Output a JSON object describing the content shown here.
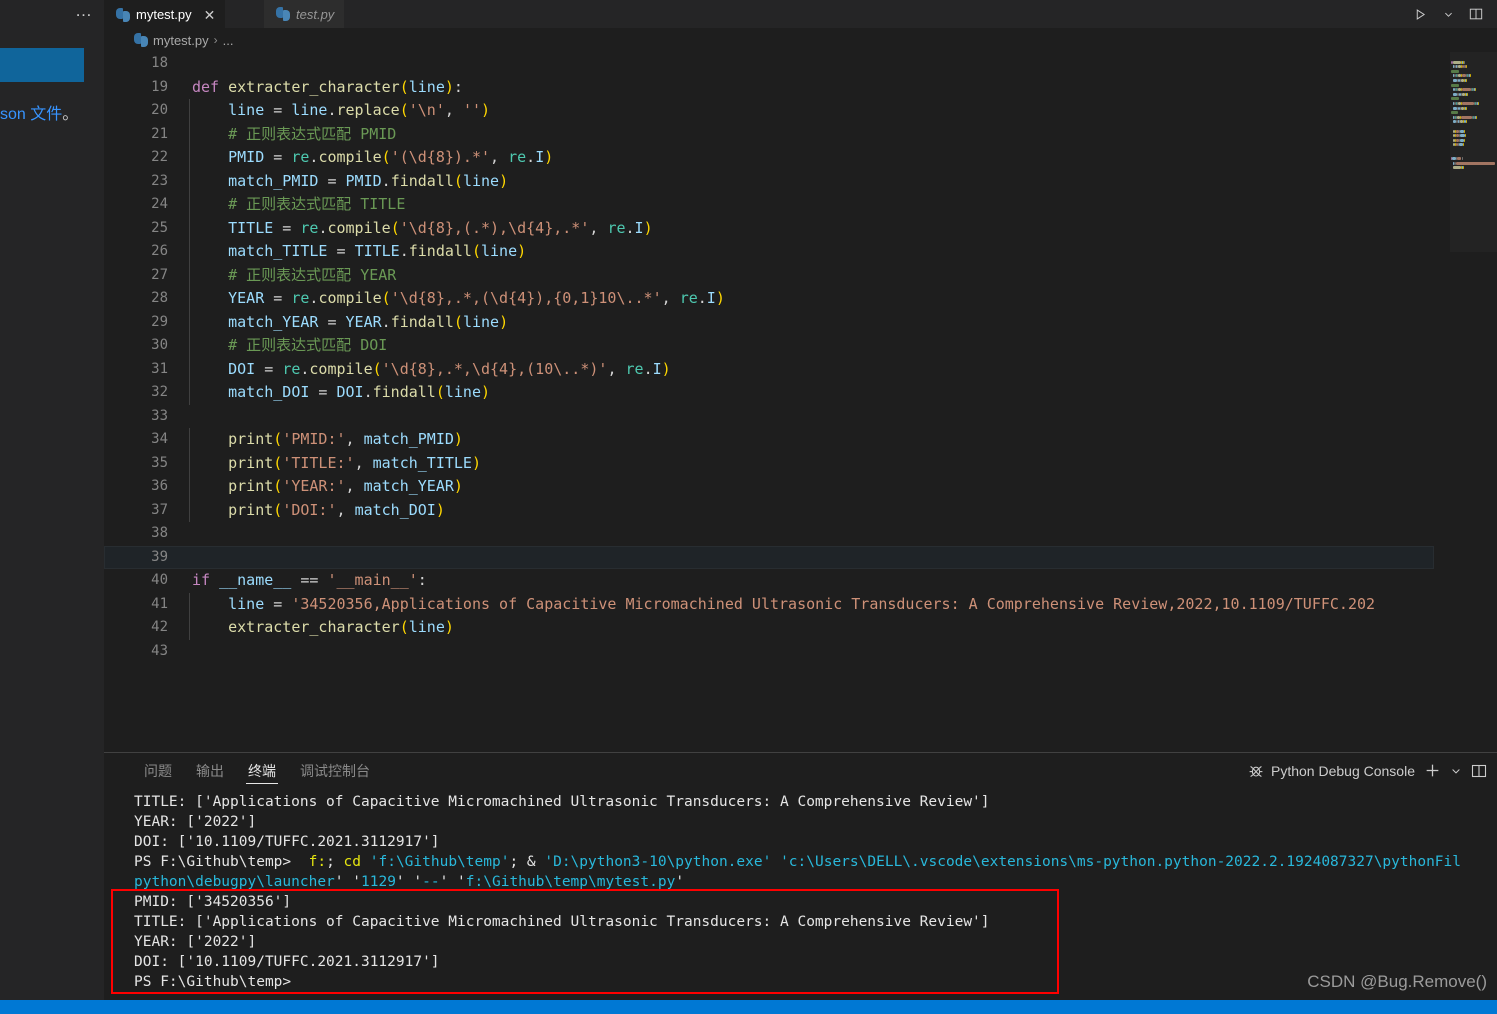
{
  "window": {
    "more_actions": "…"
  },
  "tabs": [
    {
      "label": "mytest.py",
      "icon": "python-file-icon",
      "active": true,
      "close": "✕"
    },
    {
      "label": "test.py",
      "icon": "python-file-icon",
      "active": false
    }
  ],
  "title_actions": [
    {
      "name": "run-python-file-button",
      "icon": "play-icon"
    },
    {
      "name": "run-options-dropdown",
      "icon": "chevron-down-icon"
    },
    {
      "name": "split-editor-right-button",
      "icon": "split-editor-icon"
    }
  ],
  "breadcrumb": {
    "icon": "python-file-icon",
    "file": "mytest.py",
    "separator": "›",
    "symbol": "..."
  },
  "left_panel_fragment": {
    "text_blue": "son 文件",
    "text_rest": "。"
  },
  "editor": {
    "first_line_number": 18,
    "current_line": 39,
    "lines": [
      {
        "n": 18,
        "tokens": []
      },
      {
        "n": 19,
        "tokens": [
          {
            "t": "def ",
            "c": "kw"
          },
          {
            "t": "extracter_character",
            "c": "fn"
          },
          {
            "t": "(",
            "c": "pnY"
          },
          {
            "t": "line",
            "c": "var"
          },
          {
            "t": ")",
            "c": "pnY"
          },
          {
            "t": ":",
            "c": "pn"
          }
        ]
      },
      {
        "n": 20,
        "tokens": [
          {
            "t": "    ",
            "c": "pn"
          },
          {
            "t": "line",
            "c": "var"
          },
          {
            "t": " = ",
            "c": "pn"
          },
          {
            "t": "line",
            "c": "var"
          },
          {
            "t": ".",
            "c": "pn"
          },
          {
            "t": "replace",
            "c": "fn"
          },
          {
            "t": "(",
            "c": "pnY"
          },
          {
            "t": "'\\n'",
            "c": "str"
          },
          {
            "t": ", ",
            "c": "pn"
          },
          {
            "t": "''",
            "c": "str"
          },
          {
            "t": ")",
            "c": "pnY"
          }
        ]
      },
      {
        "n": 21,
        "tokens": [
          {
            "t": "    # 正则表达式匹配 PMID",
            "c": "com"
          }
        ]
      },
      {
        "n": 22,
        "tokens": [
          {
            "t": "    ",
            "c": "pn"
          },
          {
            "t": "PMID",
            "c": "var"
          },
          {
            "t": " = ",
            "c": "pn"
          },
          {
            "t": "re",
            "c": "cls"
          },
          {
            "t": ".",
            "c": "pn"
          },
          {
            "t": "compile",
            "c": "fn"
          },
          {
            "t": "(",
            "c": "pnY"
          },
          {
            "t": "'(\\d{8}).*'",
            "c": "str"
          },
          {
            "t": ", ",
            "c": "pn"
          },
          {
            "t": "re",
            "c": "cls"
          },
          {
            "t": ".",
            "c": "pn"
          },
          {
            "t": "I",
            "c": "var"
          },
          {
            "t": ")",
            "c": "pnY"
          }
        ]
      },
      {
        "n": 23,
        "tokens": [
          {
            "t": "    ",
            "c": "pn"
          },
          {
            "t": "match_PMID",
            "c": "var"
          },
          {
            "t": " = ",
            "c": "pn"
          },
          {
            "t": "PMID",
            "c": "var"
          },
          {
            "t": ".",
            "c": "pn"
          },
          {
            "t": "findall",
            "c": "fn"
          },
          {
            "t": "(",
            "c": "pnY"
          },
          {
            "t": "line",
            "c": "var"
          },
          {
            "t": ")",
            "c": "pnY"
          }
        ]
      },
      {
        "n": 24,
        "tokens": [
          {
            "t": "    # 正则表达式匹配 TITLE",
            "c": "com"
          }
        ]
      },
      {
        "n": 25,
        "tokens": [
          {
            "t": "    ",
            "c": "pn"
          },
          {
            "t": "TITLE",
            "c": "var"
          },
          {
            "t": " = ",
            "c": "pn"
          },
          {
            "t": "re",
            "c": "cls"
          },
          {
            "t": ".",
            "c": "pn"
          },
          {
            "t": "compile",
            "c": "fn"
          },
          {
            "t": "(",
            "c": "pnY"
          },
          {
            "t": "'\\d{8},(.*),\\d{4},.*'",
            "c": "str"
          },
          {
            "t": ", ",
            "c": "pn"
          },
          {
            "t": "re",
            "c": "cls"
          },
          {
            "t": ".",
            "c": "pn"
          },
          {
            "t": "I",
            "c": "var"
          },
          {
            "t": ")",
            "c": "pnY"
          }
        ]
      },
      {
        "n": 26,
        "tokens": [
          {
            "t": "    ",
            "c": "pn"
          },
          {
            "t": "match_TITLE",
            "c": "var"
          },
          {
            "t": " = ",
            "c": "pn"
          },
          {
            "t": "TITLE",
            "c": "var"
          },
          {
            "t": ".",
            "c": "pn"
          },
          {
            "t": "findall",
            "c": "fn"
          },
          {
            "t": "(",
            "c": "pnY"
          },
          {
            "t": "line",
            "c": "var"
          },
          {
            "t": ")",
            "c": "pnY"
          }
        ]
      },
      {
        "n": 27,
        "tokens": [
          {
            "t": "    # 正则表达式匹配 YEAR",
            "c": "com"
          }
        ]
      },
      {
        "n": 28,
        "tokens": [
          {
            "t": "    ",
            "c": "pn"
          },
          {
            "t": "YEAR",
            "c": "var"
          },
          {
            "t": " = ",
            "c": "pn"
          },
          {
            "t": "re",
            "c": "cls"
          },
          {
            "t": ".",
            "c": "pn"
          },
          {
            "t": "compile",
            "c": "fn"
          },
          {
            "t": "(",
            "c": "pnY"
          },
          {
            "t": "'\\d{8},.*,(\\d{4}),{0,1}10\\..*'",
            "c": "str"
          },
          {
            "t": ", ",
            "c": "pn"
          },
          {
            "t": "re",
            "c": "cls"
          },
          {
            "t": ".",
            "c": "pn"
          },
          {
            "t": "I",
            "c": "var"
          },
          {
            "t": ")",
            "c": "pnY"
          }
        ]
      },
      {
        "n": 29,
        "tokens": [
          {
            "t": "    ",
            "c": "pn"
          },
          {
            "t": "match_YEAR",
            "c": "var"
          },
          {
            "t": " = ",
            "c": "pn"
          },
          {
            "t": "YEAR",
            "c": "var"
          },
          {
            "t": ".",
            "c": "pn"
          },
          {
            "t": "findall",
            "c": "fn"
          },
          {
            "t": "(",
            "c": "pnY"
          },
          {
            "t": "line",
            "c": "var"
          },
          {
            "t": ")",
            "c": "pnY"
          }
        ]
      },
      {
        "n": 30,
        "tokens": [
          {
            "t": "    # 正则表达式匹配 DOI",
            "c": "com"
          }
        ]
      },
      {
        "n": 31,
        "tokens": [
          {
            "t": "    ",
            "c": "pn"
          },
          {
            "t": "DOI",
            "c": "var"
          },
          {
            "t": " = ",
            "c": "pn"
          },
          {
            "t": "re",
            "c": "cls"
          },
          {
            "t": ".",
            "c": "pn"
          },
          {
            "t": "compile",
            "c": "fn"
          },
          {
            "t": "(",
            "c": "pnY"
          },
          {
            "t": "'\\d{8},.*,\\d{4},(10\\..*)'",
            "c": "str"
          },
          {
            "t": ", ",
            "c": "pn"
          },
          {
            "t": "re",
            "c": "cls"
          },
          {
            "t": ".",
            "c": "pn"
          },
          {
            "t": "I",
            "c": "var"
          },
          {
            "t": ")",
            "c": "pnY"
          }
        ]
      },
      {
        "n": 32,
        "tokens": [
          {
            "t": "    ",
            "c": "pn"
          },
          {
            "t": "match_DOI",
            "c": "var"
          },
          {
            "t": " = ",
            "c": "pn"
          },
          {
            "t": "DOI",
            "c": "var"
          },
          {
            "t": ".",
            "c": "pn"
          },
          {
            "t": "findall",
            "c": "fn"
          },
          {
            "t": "(",
            "c": "pnY"
          },
          {
            "t": "line",
            "c": "var"
          },
          {
            "t": ")",
            "c": "pnY"
          }
        ]
      },
      {
        "n": 33,
        "tokens": []
      },
      {
        "n": 34,
        "tokens": [
          {
            "t": "    ",
            "c": "pn"
          },
          {
            "t": "print",
            "c": "fn"
          },
          {
            "t": "(",
            "c": "pnY"
          },
          {
            "t": "'PMID:'",
            "c": "str"
          },
          {
            "t": ", ",
            "c": "pn"
          },
          {
            "t": "match_PMID",
            "c": "var"
          },
          {
            "t": ")",
            "c": "pnY"
          }
        ]
      },
      {
        "n": 35,
        "tokens": [
          {
            "t": "    ",
            "c": "pn"
          },
          {
            "t": "print",
            "c": "fn"
          },
          {
            "t": "(",
            "c": "pnY"
          },
          {
            "t": "'TITLE:'",
            "c": "str"
          },
          {
            "t": ", ",
            "c": "pn"
          },
          {
            "t": "match_TITLE",
            "c": "var"
          },
          {
            "t": ")",
            "c": "pnY"
          }
        ]
      },
      {
        "n": 36,
        "tokens": [
          {
            "t": "    ",
            "c": "pn"
          },
          {
            "t": "print",
            "c": "fn"
          },
          {
            "t": "(",
            "c": "pnY"
          },
          {
            "t": "'YEAR:'",
            "c": "str"
          },
          {
            "t": ", ",
            "c": "pn"
          },
          {
            "t": "match_YEAR",
            "c": "var"
          },
          {
            "t": ")",
            "c": "pnY"
          }
        ]
      },
      {
        "n": 37,
        "tokens": [
          {
            "t": "    ",
            "c": "pn"
          },
          {
            "t": "print",
            "c": "fn"
          },
          {
            "t": "(",
            "c": "pnY"
          },
          {
            "t": "'DOI:'",
            "c": "str"
          },
          {
            "t": ", ",
            "c": "pn"
          },
          {
            "t": "match_DOI",
            "c": "var"
          },
          {
            "t": ")",
            "c": "pnY"
          }
        ]
      },
      {
        "n": 38,
        "tokens": []
      },
      {
        "n": 39,
        "tokens": []
      },
      {
        "n": 40,
        "tokens": [
          {
            "t": "if ",
            "c": "kw"
          },
          {
            "t": "__name__",
            "c": "var"
          },
          {
            "t": " == ",
            "c": "pn"
          },
          {
            "t": "'__main__'",
            "c": "str"
          },
          {
            "t": ":",
            "c": "pn"
          }
        ]
      },
      {
        "n": 41,
        "tokens": [
          {
            "t": "    ",
            "c": "pn"
          },
          {
            "t": "line",
            "c": "var"
          },
          {
            "t": " = ",
            "c": "pn"
          },
          {
            "t": "'34520356,Applications of Capacitive Micromachined Ultrasonic Transducers: A Comprehensive Review,2022,10.1109/TUFFC.202",
            "c": "str"
          }
        ]
      },
      {
        "n": 42,
        "tokens": [
          {
            "t": "    ",
            "c": "pn"
          },
          {
            "t": "extracter_character",
            "c": "fn"
          },
          {
            "t": "(",
            "c": "pnY"
          },
          {
            "t": "line",
            "c": "var"
          },
          {
            "t": ")",
            "c": "pnY"
          }
        ]
      },
      {
        "n": 43,
        "tokens": []
      }
    ]
  },
  "panel": {
    "tabs": [
      {
        "label": "问题",
        "active": false
      },
      {
        "label": "输出",
        "active": false
      },
      {
        "label": "终端",
        "active": true
      },
      {
        "label": "调试控制台",
        "active": false
      }
    ],
    "terminal_selector": {
      "icon": "debug-bug-icon",
      "label": "Python Debug Console"
    },
    "actions": [
      {
        "name": "new-terminal-button",
        "icon": "plus-icon",
        "glyph": "+"
      },
      {
        "name": "terminal-profile-dropdown",
        "icon": "chevron-down-icon"
      },
      {
        "name": "split-terminal-button",
        "icon": "split-panel-icon"
      }
    ]
  },
  "terminal": {
    "lines": [
      {
        "segs": [
          {
            "t": "TITLE: ['Applications of Capacitive Micromachined Ultrasonic Transducers: A Comprehensive Review']",
            "c": "t-white"
          }
        ]
      },
      {
        "segs": [
          {
            "t": "YEAR: ['2022']",
            "c": "t-white"
          }
        ]
      },
      {
        "segs": [
          {
            "t": "DOI: ['10.1109/TUFFC.2021.3112917']",
            "c": "t-white"
          }
        ]
      },
      {
        "segs": [
          {
            "t": "PS F:\\Github\\temp>  ",
            "c": "t-white"
          },
          {
            "t": "f:",
            "c": "t-yellow"
          },
          {
            "t": "; ",
            "c": "t-white"
          },
          {
            "t": "cd",
            "c": "t-yellow"
          },
          {
            "t": " ",
            "c": "t-white"
          },
          {
            "t": "'f:\\Github\\temp'",
            "c": "t-cyan"
          },
          {
            "t": "; & ",
            "c": "t-white"
          },
          {
            "t": "'D:\\python3-10\\python.exe'",
            "c": "t-cyan"
          },
          {
            "t": " ",
            "c": "t-white"
          },
          {
            "t": "'c:\\Users\\DELL\\.vscode\\extensions\\ms-python.python-2022.2.1924087327\\pythonFil",
            "c": "t-cyan"
          }
        ]
      },
      {
        "segs": [
          {
            "t": "python\\debugpy\\launcher",
            "c": "t-cyan"
          },
          {
            "t": "' '",
            "c": "t-white"
          },
          {
            "t": "1129",
            "c": "t-cyan"
          },
          {
            "t": "' '",
            "c": "t-white"
          },
          {
            "t": "--",
            "c": "t-cyan"
          },
          {
            "t": "' '",
            "c": "t-white"
          },
          {
            "t": "f:\\Github\\temp\\mytest.py",
            "c": "t-cyan"
          },
          {
            "t": "'",
            "c": "t-white"
          }
        ]
      },
      {
        "segs": [
          {
            "t": "PMID: ['34520356']",
            "c": "t-white"
          }
        ]
      },
      {
        "segs": [
          {
            "t": "TITLE: ['Applications of Capacitive Micromachined Ultrasonic Transducers: A Comprehensive Review']",
            "c": "t-white"
          }
        ]
      },
      {
        "segs": [
          {
            "t": "YEAR: ['2022']",
            "c": "t-white"
          }
        ]
      },
      {
        "segs": [
          {
            "t": "DOI: ['10.1109/TUFFC.2021.3112917']",
            "c": "t-white"
          }
        ]
      },
      {
        "segs": [
          {
            "t": "PS F:\\Github\\temp>",
            "c": "t-white"
          }
        ]
      }
    ],
    "highlight_color": "#ff0000"
  },
  "watermark": {
    "text": "CSDN @Bug.Remove()"
  },
  "statusbar": {
    "background": "#0078d4",
    "items": []
  },
  "colors": {
    "editor_bg": "#1e1e1e",
    "tabbar_bg": "#252526",
    "accent": "#0078d4",
    "highlight_red": "#ff0000",
    "blue_box": "#10659b"
  }
}
